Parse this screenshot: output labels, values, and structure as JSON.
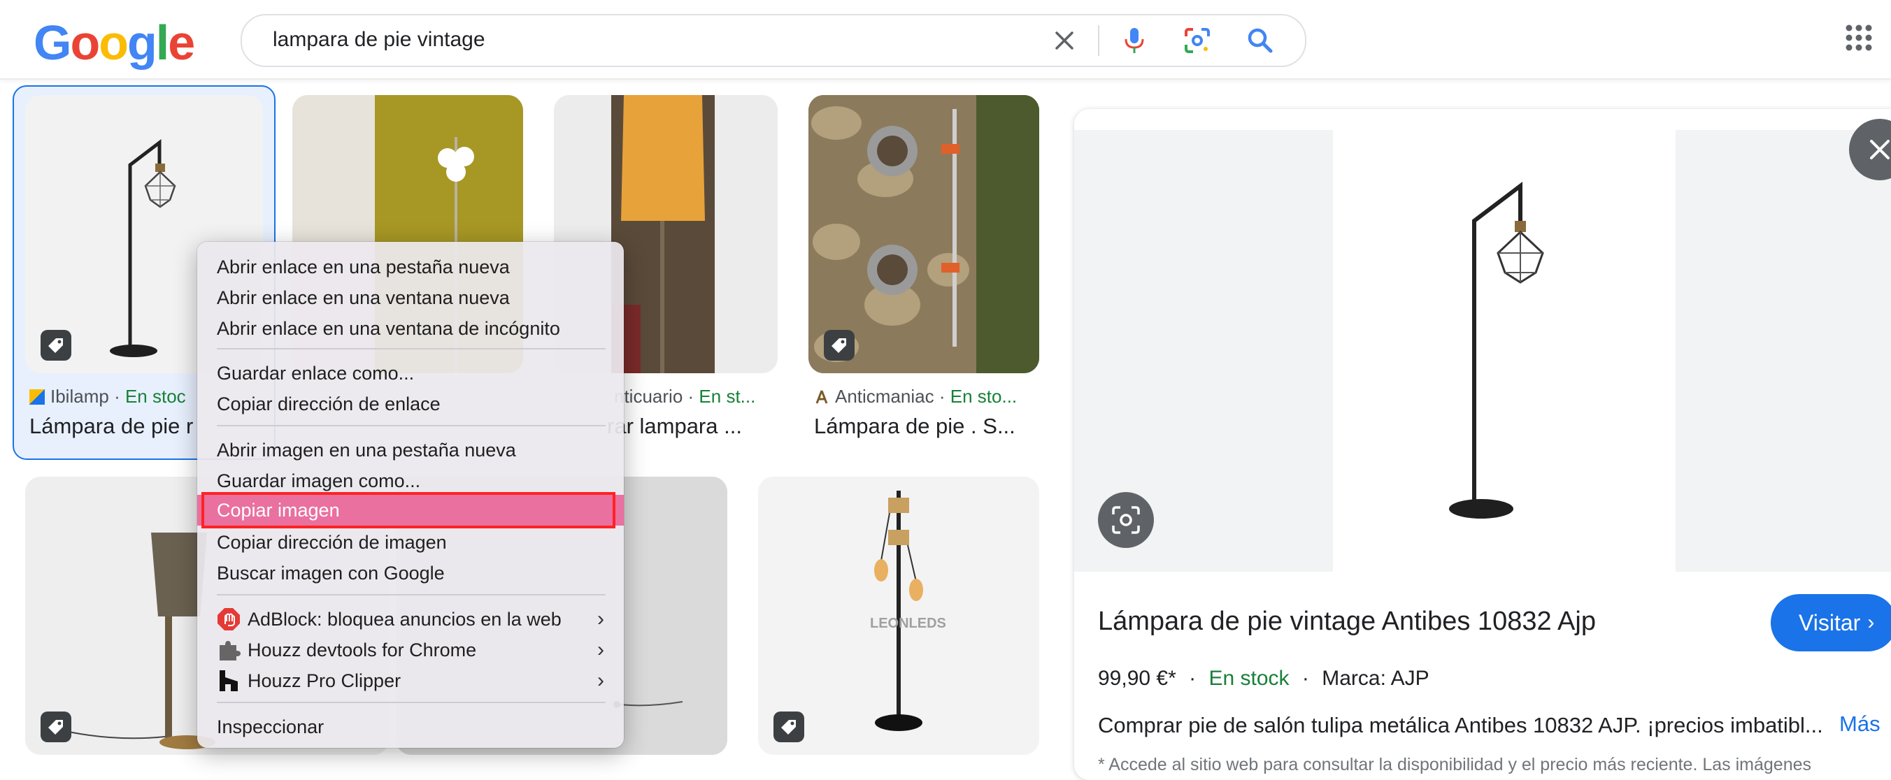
{
  "header": {
    "logo_text": "Google",
    "query": "lampara de pie vintage",
    "icons": [
      "close-icon",
      "mic-icon",
      "lens-icon",
      "search-icon",
      "apps-icon"
    ],
    "colors": {
      "blue": "#4285F4",
      "red": "#EA4335",
      "yellow": "#FBBC05",
      "green": "#34A853"
    }
  },
  "results": [
    {
      "source": "Ibilamp",
      "stock": "En stoc",
      "title": "Lámpara de pie r",
      "selected": true
    },
    {
      "source": "",
      "stock": "",
      "title": ""
    },
    {
      "source": "nticuario",
      "stock": "En st...",
      "title": "rar lampara ..."
    },
    {
      "source": "Anticmaniac",
      "stock": "En sto...",
      "title": "Lámpara de pie . S..."
    }
  ],
  "result_separator": "·",
  "watermark": "LEONLEDS",
  "context_menu": {
    "items": [
      "Abrir enlace en una pestaña nueva",
      "Abrir enlace en una ventana nueva",
      "Abrir enlace en una ventana de incógnito",
      "Guardar enlace como...",
      "Copiar dirección de enlace",
      "Abrir imagen en una pestaña nueva",
      "Guardar imagen como...",
      "Copiar imagen",
      "Copiar dirección de imagen",
      "Buscar imagen con Google",
      "AdBlock: bloquea anuncios en la web",
      "Houzz devtools for Chrome",
      "Houzz Pro Clipper",
      "Inspeccionar"
    ],
    "highlighted": "Copiar imagen",
    "highlight_color": "#e9709f",
    "outline_color": "#ff2222"
  },
  "panel": {
    "title": "Lámpara de pie vintage Antibes 10832 Ajp",
    "visit_label": "Visitar",
    "price": "99,90 €*",
    "stock": "En stock",
    "brand": "Marca: AJP",
    "dot": "·",
    "description": "Comprar pie de salón tulipa metálica Antibes 10832 AJP. ¡precios imbatibl...",
    "more_label": "Más",
    "note": "* Accede al sitio web para consultar la disponibilidad y el precio más reciente. Las imágenes"
  }
}
